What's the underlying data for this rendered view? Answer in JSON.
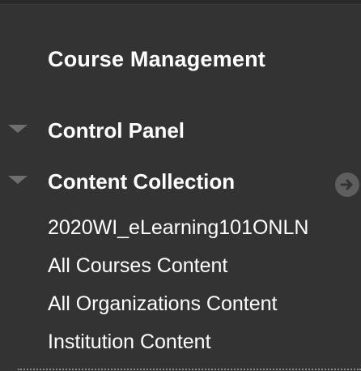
{
  "course_menu": {
    "section_title": "Course Management",
    "control_panel": {
      "label": "Control Panel",
      "expanded": true
    },
    "content_collection": {
      "label": "Content Collection",
      "expanded": true,
      "items": [
        {
          "label": "2020WI_eLearning101ONLN"
        },
        {
          "label": "All Courses Content"
        },
        {
          "label": "All Organizations Content"
        },
        {
          "label": "Institution Content"
        }
      ]
    }
  },
  "icons": {
    "toggle": "triangle-down-icon",
    "go": "arrow-right-circle-icon"
  },
  "colors": {
    "background": "#333333",
    "text": "#ffffff",
    "arrow": "#6f6f6f",
    "go_icon_bg": "#5e5e5e"
  }
}
